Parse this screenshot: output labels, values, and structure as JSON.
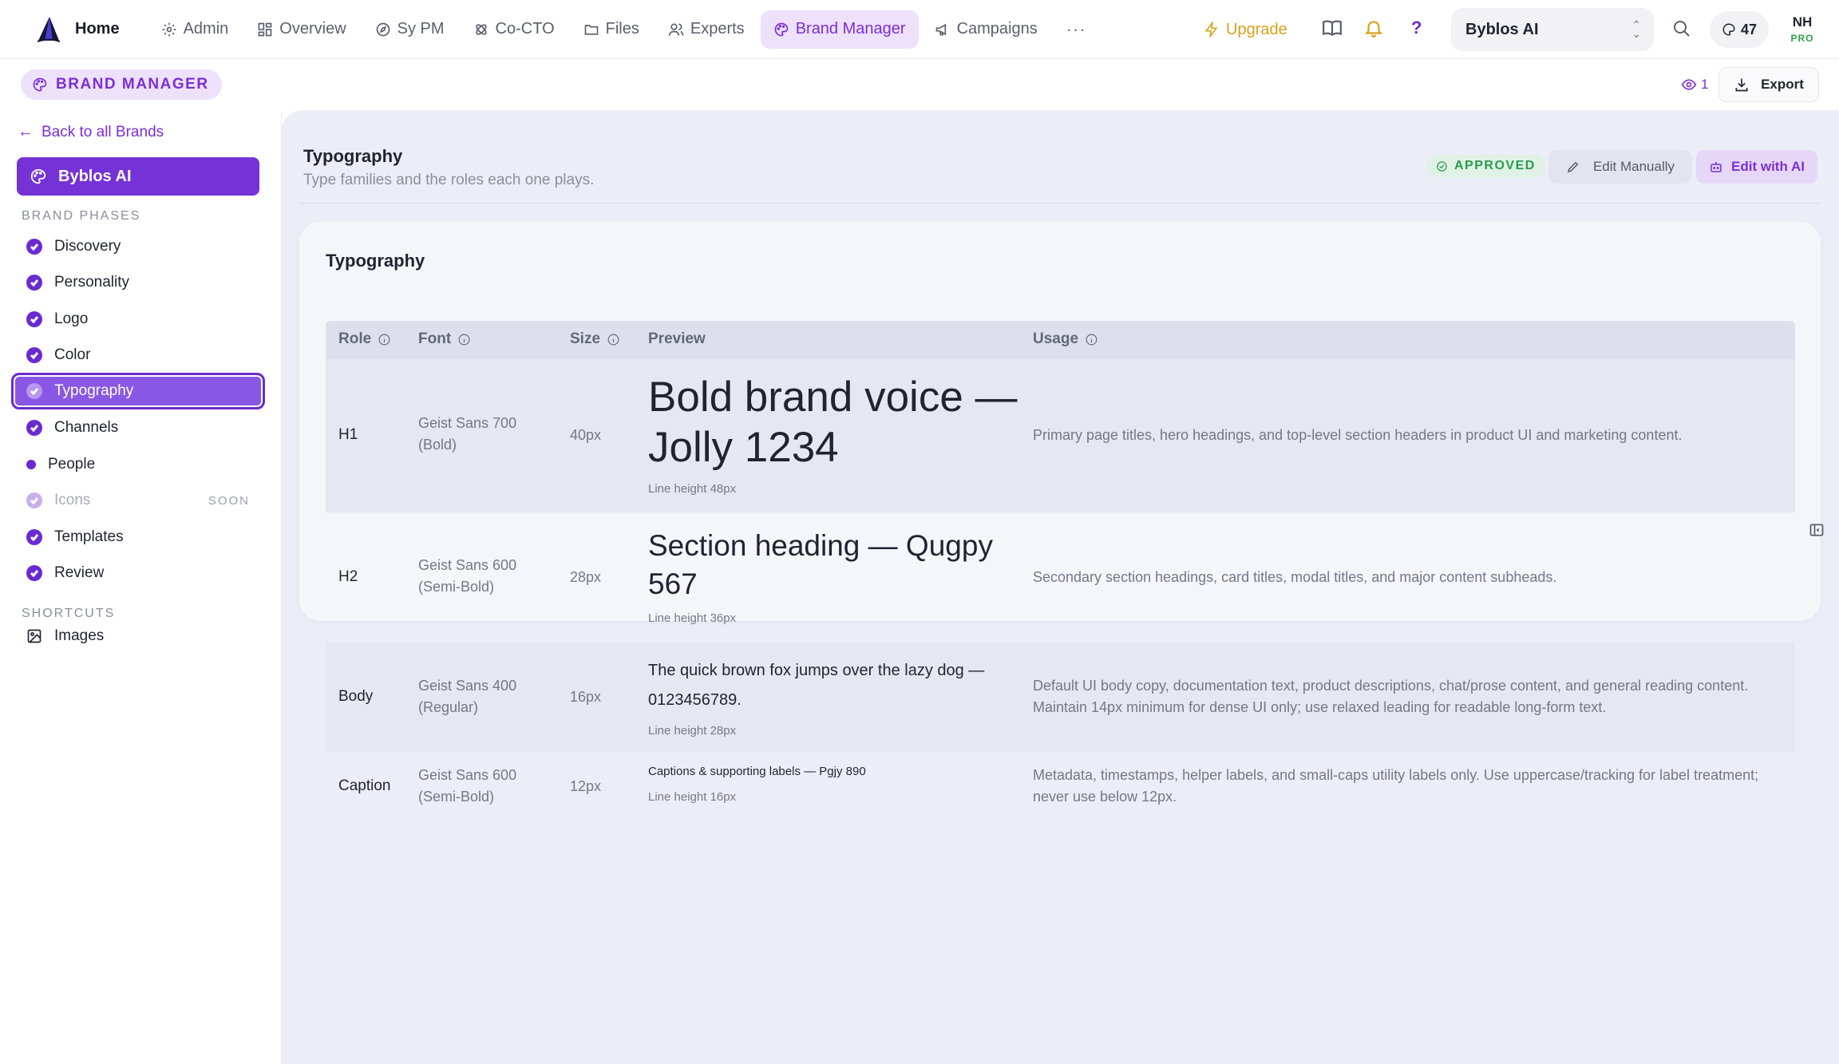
{
  "nav": {
    "home": "Home",
    "items": [
      "Admin",
      "Overview",
      "Sy PM",
      "Co-CTO",
      "Files",
      "Experts",
      "Brand Manager",
      "Campaigns"
    ],
    "more": "···",
    "upgrade": "Upgrade",
    "help": "?",
    "brand_select": "Byblos AI",
    "credits": "47",
    "avatar_initials": "NH",
    "avatar_badge": "PRO"
  },
  "subheader": {
    "pill": "BRAND MANAGER",
    "views": "1",
    "export": "Export"
  },
  "sidebar": {
    "back": "Back to all Brands",
    "brand": "Byblos AI",
    "phases_label": "BRAND PHASES",
    "phases": [
      {
        "label": "Discovery"
      },
      {
        "label": "Personality"
      },
      {
        "label": "Logo"
      },
      {
        "label": "Color"
      },
      {
        "label": "Typography"
      },
      {
        "label": "Channels"
      },
      {
        "label": "People"
      },
      {
        "label": "Icons",
        "badge": "SOON"
      },
      {
        "label": "Templates"
      },
      {
        "label": "Review"
      }
    ],
    "shortcuts_label": "SHORTCUTS",
    "shortcuts": [
      {
        "label": "Images"
      }
    ]
  },
  "main": {
    "title": "Typography",
    "subtitle": "Type families and the roles each one plays.",
    "status": "APPROVED",
    "edit_manual": "Edit Manually",
    "edit_ai": "Edit with AI",
    "card_title": "Typography",
    "columns": [
      "Role",
      "Font",
      "Size",
      "Preview",
      "Usage"
    ],
    "rows": [
      {
        "role": "H1",
        "font": "Geist Sans 700 (Bold)",
        "size": "40px",
        "preview": "Bold brand voice — Jolly 1234",
        "line_height": "Line height 48px",
        "usage": "Primary page titles, hero headings, and top-level section headers in product UI and marketing content."
      },
      {
        "role": "H2",
        "font": "Geist Sans 600 (Semi-Bold)",
        "size": "28px",
        "preview": "Section heading — Qugpy 567",
        "line_height": "Line height 36px",
        "usage": "Secondary section headings, card titles, modal titles, and major content subheads."
      },
      {
        "role": "Body",
        "font": "Geist Sans 400 (Regular)",
        "size": "16px",
        "preview": "The quick brown fox jumps over the lazy dog — 0123456789.",
        "line_height": "Line height 28px",
        "usage": "Default UI body copy, documentation text, product descriptions, chat/prose content, and general reading content. Maintain 14px minimum for dense UI only; use relaxed leading for readable long-form text."
      },
      {
        "role": "Caption",
        "font": "Geist Sans 600 (Semi-Bold)",
        "size": "12px",
        "preview": "Captions & supporting labels — Pgjy 890",
        "line_height": "Line height 16px",
        "usage": "Metadata, timestamps, helper labels, and small-caps utility labels only. Use uppercase/tracking for label treatment; never use below 12px."
      }
    ]
  },
  "colors": {
    "accent": "#7532d6",
    "approved": "#2a9a4c",
    "upgrade": "#d9a21b"
  }
}
